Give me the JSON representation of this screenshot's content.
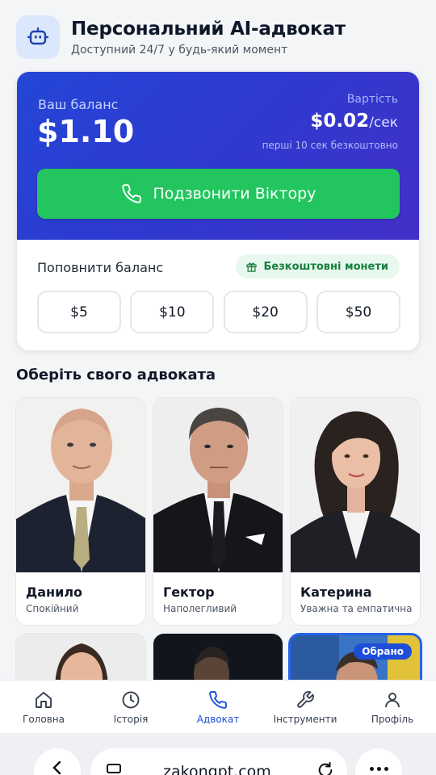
{
  "header": {
    "icon": "robot-icon",
    "title": "Персональний AI-адвокат",
    "subtitle": "Доступний 24/7 у будь-який момент"
  },
  "balance": {
    "label": "Ваш баланс",
    "value": "$1.10",
    "cost_label": "Вартість",
    "cost_value": "$0.02",
    "cost_unit": "/сек",
    "cost_note": "перші 10 сек безкоштовно",
    "call_button": "Подзвонити Віктору",
    "call_icon": "phone-icon",
    "accent_color": "#2f39cf",
    "call_color": "#22c55e"
  },
  "topup": {
    "label": "Поповнити баланс",
    "free_coins": "Безкоштовні монети",
    "free_coins_icon": "gift-icon",
    "amounts": [
      "$5",
      "$10",
      "$20",
      "$50"
    ]
  },
  "lawyers": {
    "section_title": "Оберіть свого адвоката",
    "items": [
      {
        "name": "Данило",
        "desc": "Спокійний"
      },
      {
        "name": "Гектор",
        "desc": "Наполегливий"
      },
      {
        "name": "Катерина",
        "desc": "Уважна та емпатична"
      }
    ],
    "selected_badge": "Обрано"
  },
  "nav": {
    "items": [
      {
        "label": "Головна",
        "icon": "home-icon"
      },
      {
        "label": "Історія",
        "icon": "clock-icon"
      },
      {
        "label": "Адвокат",
        "icon": "phone-icon"
      },
      {
        "label": "Інструменти",
        "icon": "wrench-icon"
      },
      {
        "label": "Профіль",
        "icon": "user-icon"
      }
    ],
    "active": "Адвокат"
  },
  "browser": {
    "url": "zakongpt.com"
  }
}
